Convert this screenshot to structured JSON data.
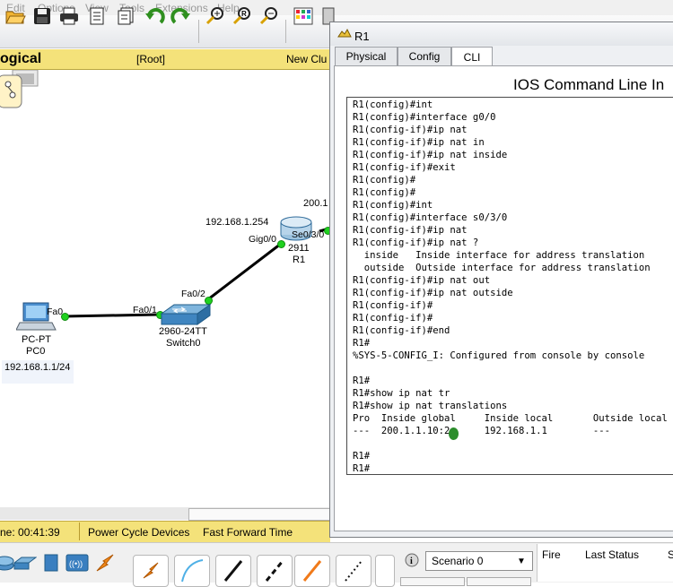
{
  "menu": [
    "Edit",
    "Options",
    "View",
    "Tools",
    "Extensions",
    "Help"
  ],
  "toolbar": {
    "icons": [
      "open-folder-icon",
      "save-icon",
      "print-icon",
      "activity-wizard-icon",
      "notes-icon",
      "undo-icon",
      "redo-icon",
      "zoom-in-icon",
      "zoom-reset-icon",
      "zoom-out-icon",
      "palette-icon",
      "custom-device-icon"
    ]
  },
  "workspace": {
    "mode": "ogical",
    "root": "[Root]",
    "new_cluster": "New Clu"
  },
  "network": {
    "pc": {
      "type": "PC-PT",
      "name": "PC0",
      "ip": "192.168.1.1/24",
      "port": "Fa0"
    },
    "switch": {
      "model": "2960-24TT",
      "name": "Switch0",
      "port_pc": "Fa0/1",
      "port_router": "Fa0/2"
    },
    "router": {
      "model": "2911",
      "name": "R1",
      "port_lan": "Gig0/0",
      "port_wan": "Se0/3/0",
      "ip_lan": "192.168.1.254",
      "ip_wan": "200.1"
    }
  },
  "status": {
    "time": "ne: 00:41:39",
    "power_cycle": "Power Cycle Devices",
    "fast_forward": "Fast Forward Time"
  },
  "bottom": {
    "scenario": "Scenario 0",
    "columns": [
      "Fire",
      "Last Status",
      "S"
    ]
  },
  "r1_window": {
    "title": "R1",
    "tabs": [
      "Physical",
      "Config",
      "CLI"
    ],
    "active_tab": "CLI",
    "header": "IOS Command Line In",
    "console_lines": [
      "R1(config)#int",
      "R1(config)#interface g0/0",
      "R1(config-if)#ip nat",
      "R1(config-if)#ip nat in",
      "R1(config-if)#ip nat inside",
      "R1(config-if)#exit",
      "R1(config)#",
      "R1(config)#",
      "R1(config)#int",
      "R1(config)#interface s0/3/0",
      "R1(config-if)#ip nat",
      "R1(config-if)#ip nat ?",
      "  inside   Inside interface for address translation",
      "  outside  Outside interface for address translation",
      "R1(config-if)#ip nat out",
      "R1(config-if)#ip nat outside",
      "R1(config-if)#",
      "R1(config-if)#",
      "R1(config-if)#end",
      "R1#",
      "%SYS-5-CONFIG_I: Configured from console by console",
      "",
      "R1#",
      "R1#show ip nat tr",
      "R1#show ip nat translations",
      "Pro  Inside global     Inside local       Outside local",
      "---  200.1.1.10:2      192.168.1.1        ---",
      "",
      "R1#",
      "R1#"
    ]
  },
  "colors": {
    "workspace_bar": "#f4e27a",
    "link": "#000000",
    "port_up": "#1fd11f"
  }
}
